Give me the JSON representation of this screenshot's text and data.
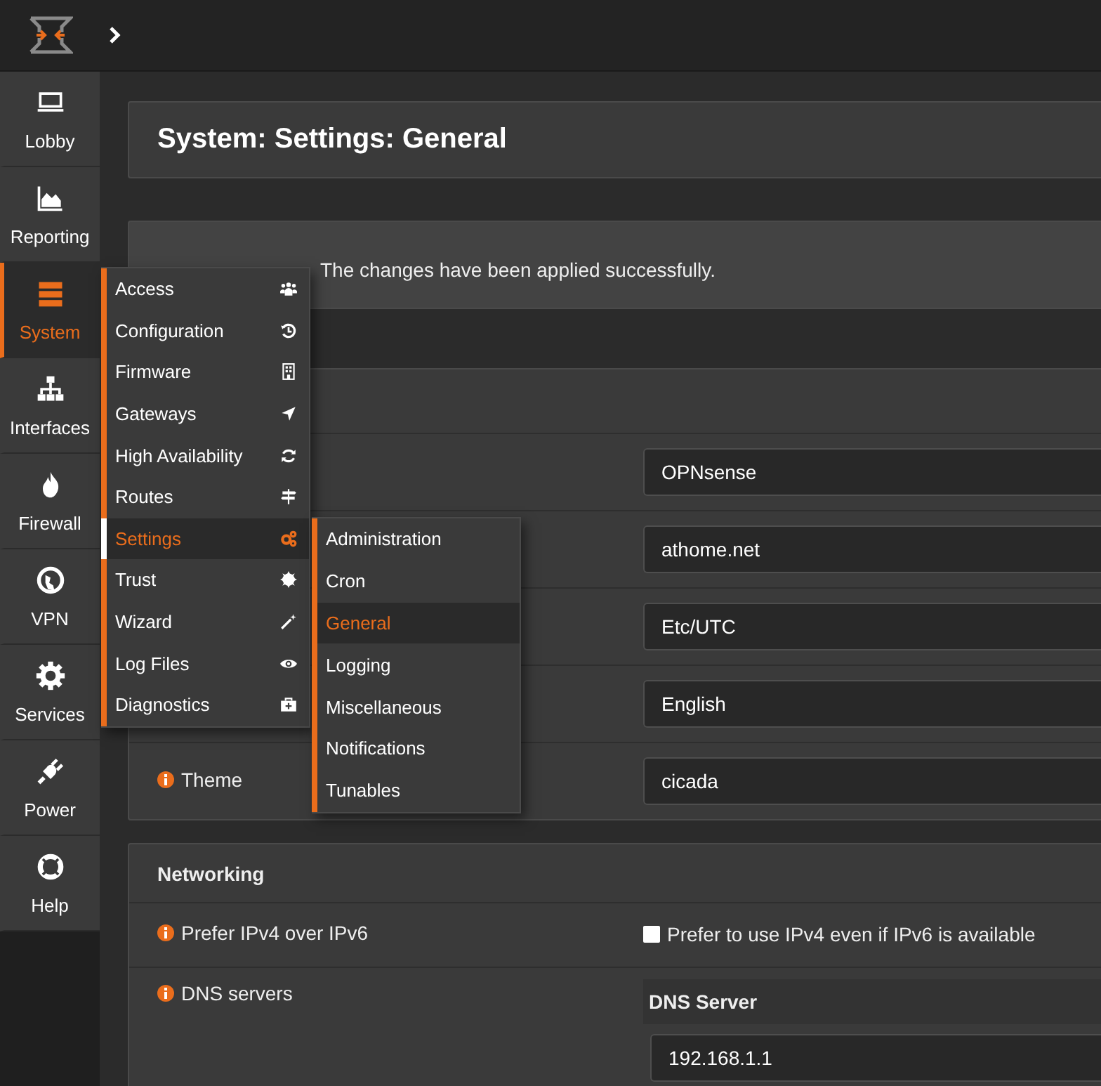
{
  "sidebar": {
    "items": [
      {
        "label": "Lobby",
        "selected": false
      },
      {
        "label": "Reporting",
        "selected": false
      },
      {
        "label": "System",
        "selected": true
      },
      {
        "label": "Interfaces",
        "selected": false
      },
      {
        "label": "Firewall",
        "selected": false
      },
      {
        "label": "VPN",
        "selected": false
      },
      {
        "label": "Services",
        "selected": false
      },
      {
        "label": "Power",
        "selected": false
      },
      {
        "label": "Help",
        "selected": false
      }
    ]
  },
  "page_title": "System: Settings: General",
  "message": "The changes have been applied successfully.",
  "general_section": {
    "rows": [
      {
        "value": "OPNsense"
      },
      {
        "value": "athome.net"
      },
      {
        "value": "Etc/UTC"
      },
      {
        "value": "English"
      },
      {
        "label": "Theme",
        "value": "cicada"
      }
    ]
  },
  "networking_section": {
    "title": "Networking",
    "prefer_ipv4": {
      "label": "Prefer IPv4 over IPv6",
      "checkbox_label": "Prefer to use IPv4 even if IPv6 is available",
      "checked": false
    },
    "dns_servers": {
      "label": "DNS servers",
      "column": "DNS Server",
      "values": [
        "192.168.1.1"
      ]
    }
  },
  "system_menu": {
    "items": [
      {
        "label": "Access",
        "selected": false
      },
      {
        "label": "Configuration",
        "selected": false
      },
      {
        "label": "Firmware",
        "selected": false
      },
      {
        "label": "Gateways",
        "selected": false
      },
      {
        "label": "High Availability",
        "selected": false
      },
      {
        "label": "Routes",
        "selected": false
      },
      {
        "label": "Settings",
        "selected": true
      },
      {
        "label": "Trust",
        "selected": false
      },
      {
        "label": "Wizard",
        "selected": false
      },
      {
        "label": "Log Files",
        "selected": false
      },
      {
        "label": "Diagnostics",
        "selected": false
      }
    ]
  },
  "settings_submenu": {
    "items": [
      {
        "label": "Administration",
        "selected": false
      },
      {
        "label": "Cron",
        "selected": false
      },
      {
        "label": "General",
        "selected": true
      },
      {
        "label": "Logging",
        "selected": false
      },
      {
        "label": "Miscellaneous",
        "selected": false
      },
      {
        "label": "Notifications",
        "selected": false
      },
      {
        "label": "Tunables",
        "selected": false
      }
    ]
  }
}
